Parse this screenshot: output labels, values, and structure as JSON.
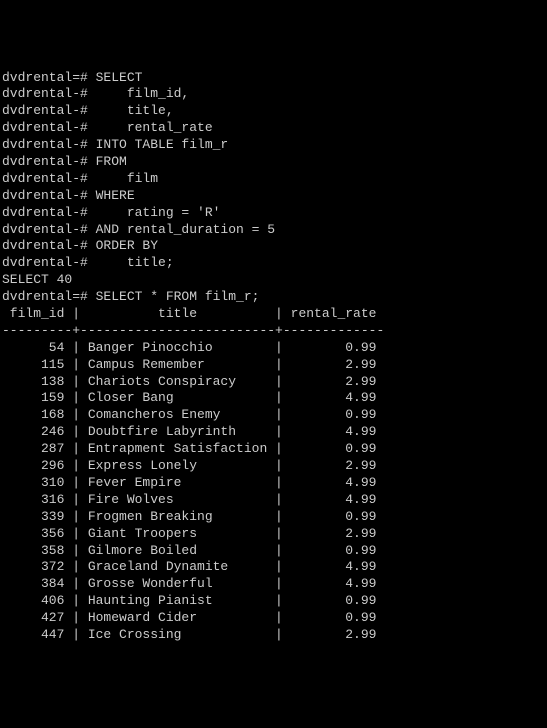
{
  "prompt_primary": "dvdrental=#",
  "prompt_secondary": "dvdrental-#",
  "query_lines": [
    "SELECT",
    "    film_id,",
    "    title,",
    "    rental_rate",
    "INTO TABLE film_r",
    "FROM",
    "    film",
    "WHERE",
    "    rating = 'R'",
    "AND rental_duration = 5",
    "ORDER BY",
    "    title;"
  ],
  "result_msg": "SELECT 40",
  "second_query": "SELECT * FROM film_r;",
  "headers": {
    "film_id": "film_id",
    "title": "title",
    "rental_rate": "rental_rate"
  },
  "separator": "---------+-------------------------+-------------",
  "rows": [
    {
      "film_id": "54",
      "title": "Banger Pinocchio",
      "rental_rate": "0.99"
    },
    {
      "film_id": "115",
      "title": "Campus Remember",
      "rental_rate": "2.99"
    },
    {
      "film_id": "138",
      "title": "Chariots Conspiracy",
      "rental_rate": "2.99"
    },
    {
      "film_id": "159",
      "title": "Closer Bang",
      "rental_rate": "4.99"
    },
    {
      "film_id": "168",
      "title": "Comancheros Enemy",
      "rental_rate": "0.99"
    },
    {
      "film_id": "246",
      "title": "Doubtfire Labyrinth",
      "rental_rate": "4.99"
    },
    {
      "film_id": "287",
      "title": "Entrapment Satisfaction",
      "rental_rate": "0.99"
    },
    {
      "film_id": "296",
      "title": "Express Lonely",
      "rental_rate": "2.99"
    },
    {
      "film_id": "310",
      "title": "Fever Empire",
      "rental_rate": "4.99"
    },
    {
      "film_id": "316",
      "title": "Fire Wolves",
      "rental_rate": "4.99"
    },
    {
      "film_id": "339",
      "title": "Frogmen Breaking",
      "rental_rate": "0.99"
    },
    {
      "film_id": "356",
      "title": "Giant Troopers",
      "rental_rate": "2.99"
    },
    {
      "film_id": "358",
      "title": "Gilmore Boiled",
      "rental_rate": "0.99"
    },
    {
      "film_id": "372",
      "title": "Graceland Dynamite",
      "rental_rate": "4.99"
    },
    {
      "film_id": "384",
      "title": "Grosse Wonderful",
      "rental_rate": "4.99"
    },
    {
      "film_id": "406",
      "title": "Haunting Pianist",
      "rental_rate": "0.99"
    },
    {
      "film_id": "427",
      "title": "Homeward Cider",
      "rental_rate": "0.99"
    },
    {
      "film_id": "447",
      "title": "Ice Crossing",
      "rental_rate": "2.99"
    }
  ]
}
